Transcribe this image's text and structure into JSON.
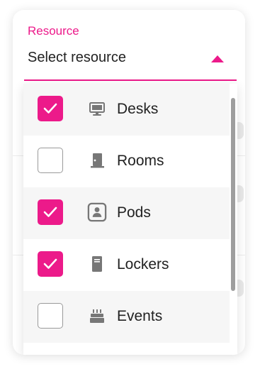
{
  "field": {
    "label": "Resource",
    "placeholder": "Select resource",
    "accent_color": "#ec1a8a"
  },
  "options": [
    {
      "label": "Desks",
      "checked": true,
      "icon": "monitor-icon"
    },
    {
      "label": "Rooms",
      "checked": false,
      "icon": "door-icon"
    },
    {
      "label": "Pods",
      "checked": true,
      "icon": "pod-icon"
    },
    {
      "label": "Lockers",
      "checked": true,
      "icon": "locker-icon"
    },
    {
      "label": "Events",
      "checked": false,
      "icon": "cake-icon"
    }
  ]
}
